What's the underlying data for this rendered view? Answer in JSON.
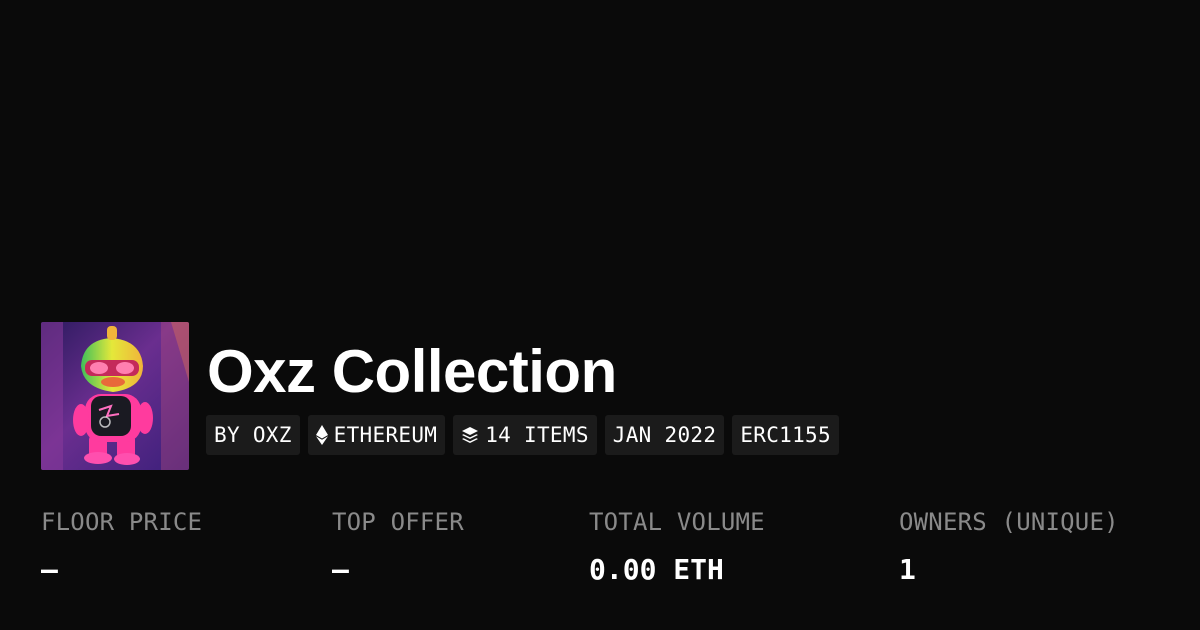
{
  "collection": {
    "name": "Oxz Collection",
    "avatar_icon": "collection-avatar-pink-duck-figure",
    "tags": [
      {
        "label": "BY OXZ",
        "icon": null
      },
      {
        "label": "ETHEREUM",
        "icon": "ethereum-icon"
      },
      {
        "label": "14 ITEMS",
        "icon": "layers-icon"
      },
      {
        "label": "JAN 2022",
        "icon": null
      },
      {
        "label": "ERC1155",
        "icon": null
      }
    ]
  },
  "stats": [
    {
      "label": "FLOOR PRICE",
      "value": "–"
    },
    {
      "label": "TOP OFFER",
      "value": "–"
    },
    {
      "label": "TOTAL VOLUME",
      "value": "0.00 ETH"
    },
    {
      "label": "OWNERS (UNIQUE)",
      "value": "1"
    }
  ],
  "colors": {
    "background": "#0a0a0a",
    "tag_background": "#1b1b1b",
    "label_gray": "#8a8a8a",
    "text": "#ffffff"
  }
}
